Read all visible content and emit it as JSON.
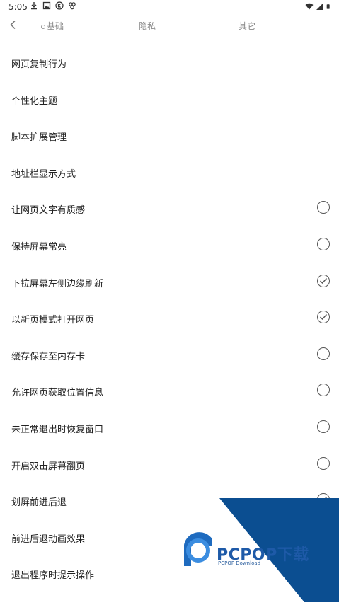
{
  "status_bar": {
    "time": "5:05",
    "left_icons": [
      "download-icon",
      "gallery-icon",
      "k-icon",
      "app-icon"
    ],
    "right_icons": [
      "wifi-icon",
      "signal-icon",
      "battery-icon"
    ]
  },
  "tabs": [
    {
      "label": "基础",
      "active": true
    },
    {
      "label": "隐私",
      "active": false
    },
    {
      "label": "其它",
      "active": false
    }
  ],
  "settings": [
    {
      "label": "网页复制行为",
      "control": "none"
    },
    {
      "label": "个性化主题",
      "control": "none"
    },
    {
      "label": "脚本扩展管理",
      "control": "none"
    },
    {
      "label": "地址栏显示方式",
      "control": "none"
    },
    {
      "label": "让网页文字有质感",
      "control": "radio",
      "checked": false
    },
    {
      "label": "保持屏幕常亮",
      "control": "radio",
      "checked": false
    },
    {
      "label": "下拉屏幕左侧边缘刷新",
      "control": "radio",
      "checked": true
    },
    {
      "label": "以新页模式打开网页",
      "control": "radio",
      "checked": true
    },
    {
      "label": "缓存保存至内存卡",
      "control": "radio",
      "checked": false
    },
    {
      "label": "允许网页获取位置信息",
      "control": "radio",
      "checked": false
    },
    {
      "label": "未正常退出时恢复窗口",
      "control": "radio",
      "checked": false
    },
    {
      "label": "开启双击屏幕翻页",
      "control": "radio",
      "checked": false
    },
    {
      "label": "划屏前进后退",
      "control": "radio",
      "checked": true
    },
    {
      "label": "前进后退动画效果",
      "control": "radio",
      "checked": false
    },
    {
      "label": "退出程序时提示操作",
      "control": "radio",
      "checked": false
    }
  ],
  "watermark": {
    "brand": "PCPOP下载",
    "sub": "PCPOP Download"
  },
  "colors": {
    "radio_border": "#555555",
    "watermark_blue": "#0b4e91"
  }
}
